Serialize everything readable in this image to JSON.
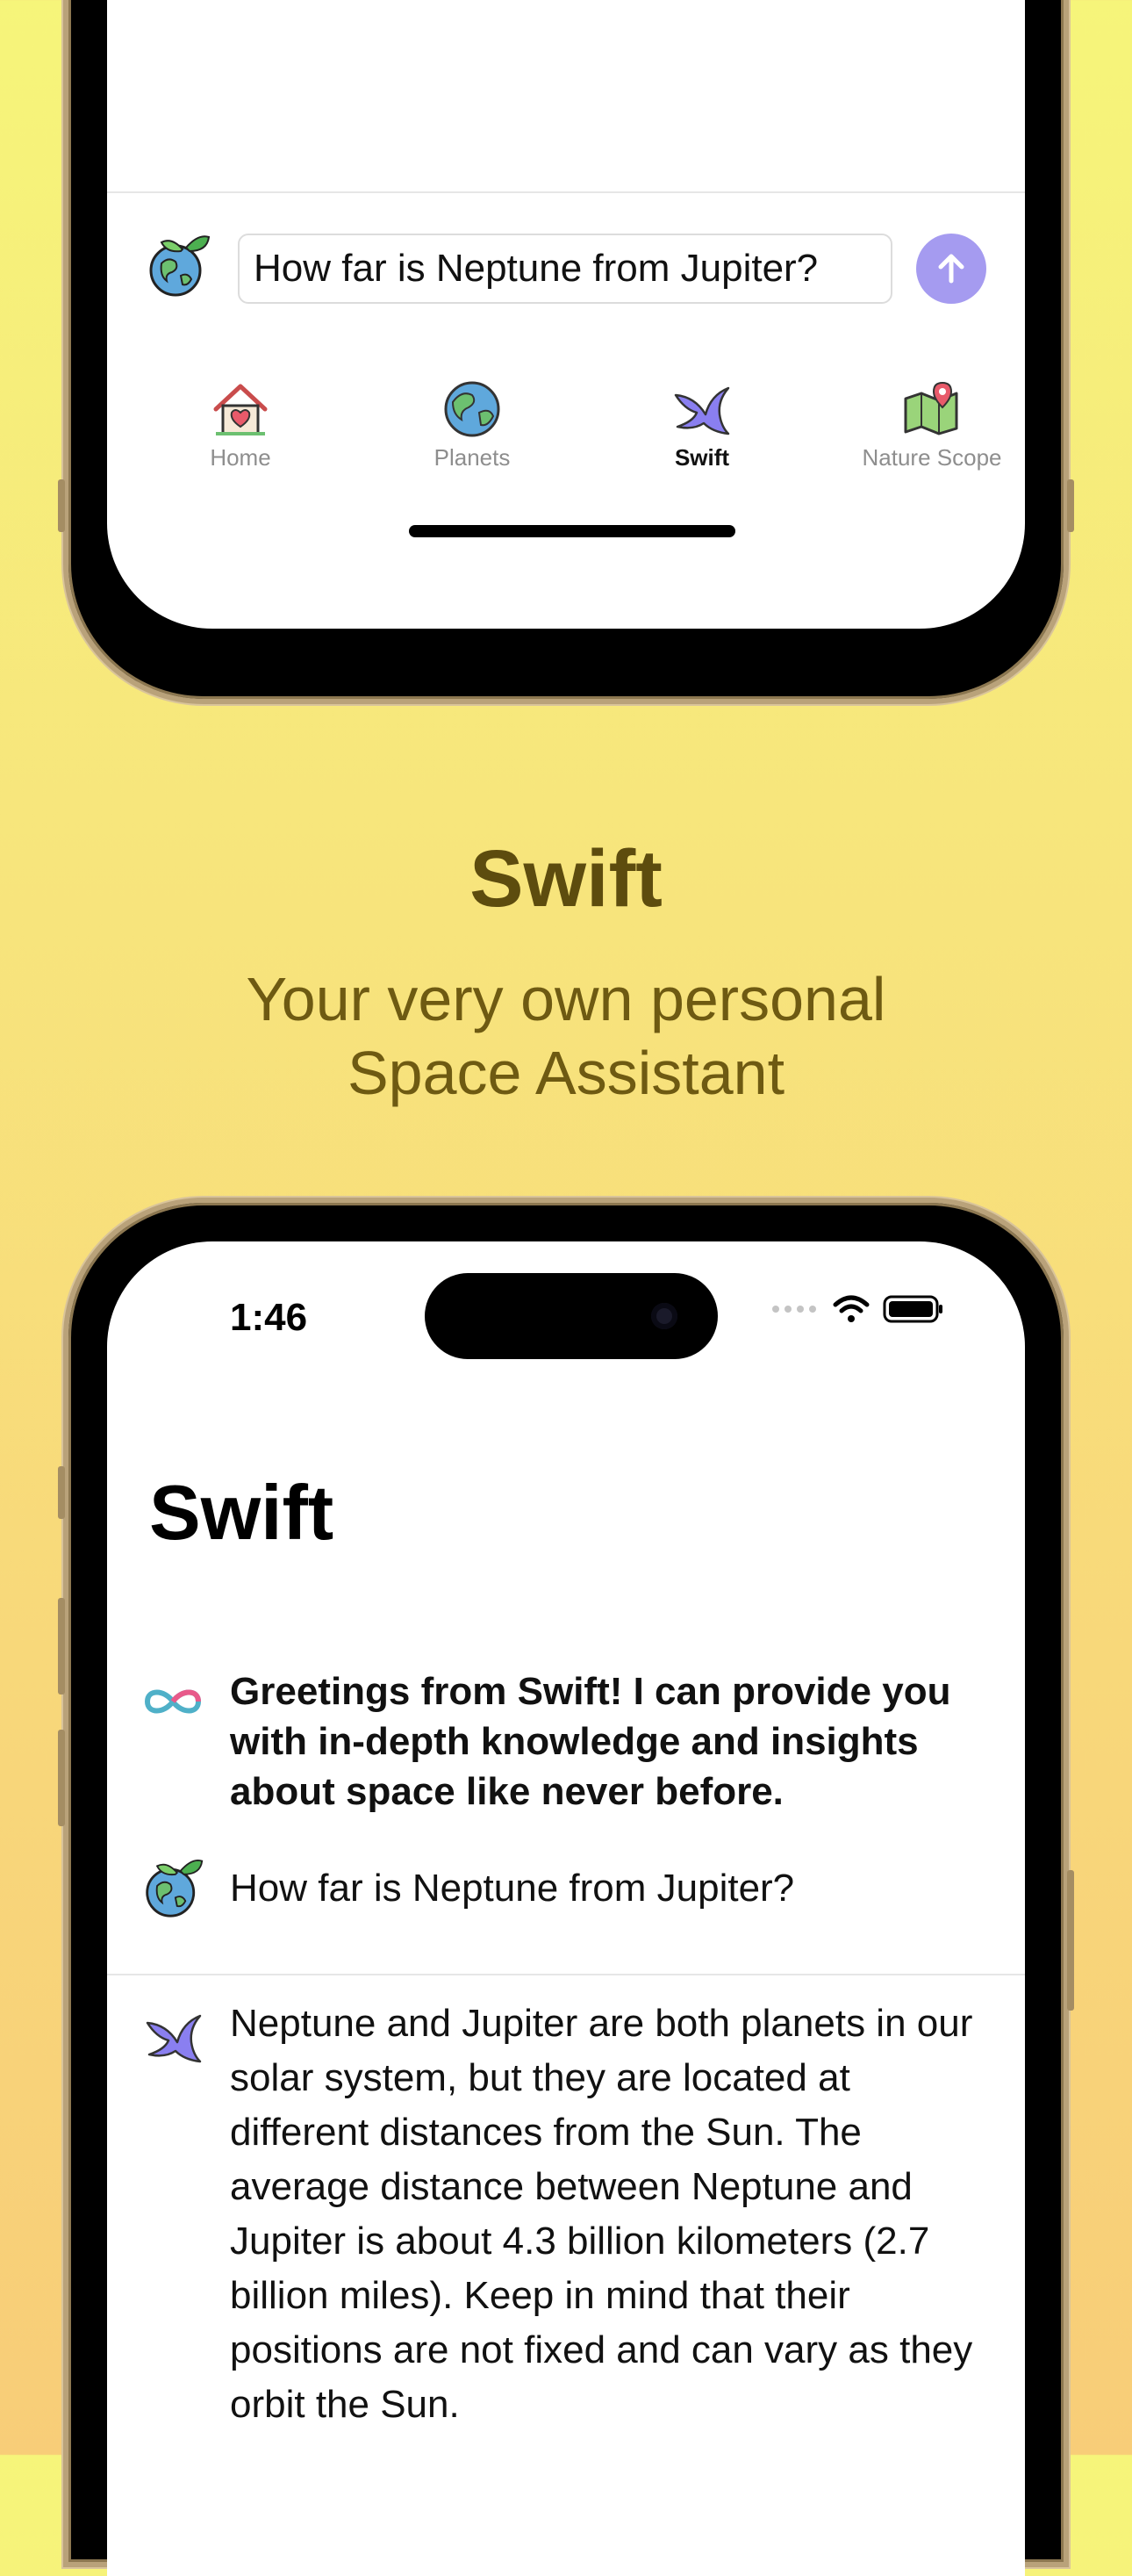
{
  "top_phone": {
    "chat_input_value": "How far is Neptune from Jupiter?",
    "tabs": [
      {
        "label": "Home",
        "icon": "home-icon",
        "active": false
      },
      {
        "label": "Planets",
        "icon": "globe-icon",
        "active": false
      },
      {
        "label": "Swift",
        "icon": "swift-bird-icon",
        "active": true
      },
      {
        "label": "Nature Scope",
        "icon": "map-icon",
        "active": false
      }
    ]
  },
  "hero": {
    "title": "Swift",
    "subtitle_line1": "Your very own personal",
    "subtitle_line2": "Space Assistant"
  },
  "bottom_phone": {
    "status_time": "1:46",
    "page_title": "Swift",
    "messages": [
      {
        "sender_icon": "infinity-icon",
        "text": "Greetings from Swift! I can provide you with in-depth knowledge and insights about space like never before."
      },
      {
        "sender_icon": "eco-globe-icon",
        "text": "How far is Neptune from Jupiter?"
      },
      {
        "sender_icon": "swift-bird-icon",
        "text": "Neptune and Jupiter are both planets in our solar system, but they are located at different distances from the Sun. The average distance between Neptune and Jupiter is about 4.3 billion kilometers (2.7 billion miles). Keep in mind that their positions are not fixed and can vary as they orbit the Sun."
      }
    ]
  },
  "colors": {
    "accent_send": "#a59bf0",
    "hero_title": "#5d4c0e",
    "hero_subtitle": "#6e5a12",
    "frame_gold": "#b9a27a"
  }
}
